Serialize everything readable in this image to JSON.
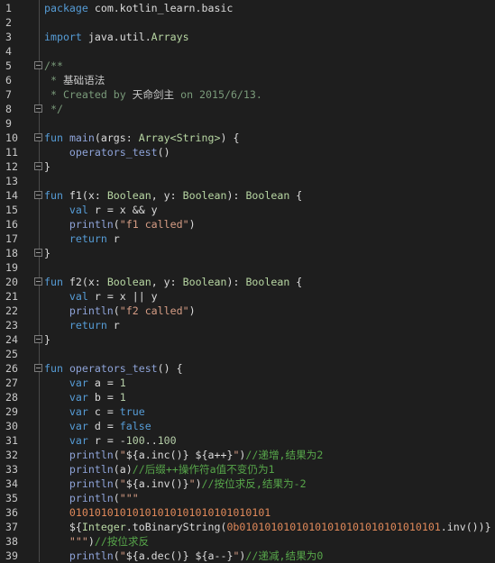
{
  "editor": {
    "language": "kotlin",
    "lines": [
      {
        "n": "1",
        "tokens": [
          [
            "kw",
            "package"
          ],
          [
            "pl",
            " com.kotlin_learn.basic"
          ]
        ]
      },
      {
        "n": "2",
        "tokens": []
      },
      {
        "n": "3",
        "tokens": [
          [
            "kw",
            "import"
          ],
          [
            "pl",
            " java.util."
          ],
          [
            "ty",
            "Arrays"
          ]
        ]
      },
      {
        "n": "4",
        "tokens": []
      },
      {
        "n": "5",
        "fold": "start",
        "tokens": [
          [
            "doc",
            "/**"
          ]
        ]
      },
      {
        "n": "6",
        "tokens": [
          [
            "doc",
            " * "
          ],
          [
            "docT",
            "基础语法"
          ]
        ]
      },
      {
        "n": "7",
        "tokens": [
          [
            "doc",
            " * Created by "
          ],
          [
            "docT",
            "天命剑主"
          ],
          [
            "doc",
            " on 2015/6/13."
          ]
        ]
      },
      {
        "n": "8",
        "fold": "end",
        "tokens": [
          [
            "doc",
            " */"
          ]
        ]
      },
      {
        "n": "9",
        "tokens": []
      },
      {
        "n": "10",
        "fold": "start",
        "tokens": [
          [
            "kw",
            "fun"
          ],
          [
            "pl",
            " "
          ],
          [
            "fn",
            "main"
          ],
          [
            "pl",
            "(args: "
          ],
          [
            "ty",
            "Array<String>"
          ],
          [
            "pl",
            ") {"
          ]
        ]
      },
      {
        "n": "11",
        "tokens": [
          [
            "pl",
            "    "
          ],
          [
            "fn",
            "operators_test"
          ],
          [
            "pl",
            "()"
          ]
        ]
      },
      {
        "n": "12",
        "fold": "end",
        "tokens": [
          [
            "pl",
            "}"
          ]
        ]
      },
      {
        "n": "13",
        "tokens": []
      },
      {
        "n": "14",
        "fold": "start",
        "tokens": [
          [
            "kw",
            "fun"
          ],
          [
            "pl",
            " f1(x: "
          ],
          [
            "ty",
            "Boolean"
          ],
          [
            "pl",
            ", y: "
          ],
          [
            "ty",
            "Boolean"
          ],
          [
            "pl",
            "): "
          ],
          [
            "ty",
            "Boolean"
          ],
          [
            "pl",
            " {"
          ]
        ]
      },
      {
        "n": "15",
        "tokens": [
          [
            "pl",
            "    "
          ],
          [
            "kw",
            "val"
          ],
          [
            "pl",
            " r = x && y"
          ]
        ]
      },
      {
        "n": "16",
        "tokens": [
          [
            "pl",
            "    "
          ],
          [
            "fn",
            "println"
          ],
          [
            "pl",
            "("
          ],
          [
            "str",
            "\"f1 called\""
          ],
          [
            "pl",
            ")"
          ]
        ]
      },
      {
        "n": "17",
        "tokens": [
          [
            "pl",
            "    "
          ],
          [
            "kw",
            "return"
          ],
          [
            "pl",
            " r"
          ]
        ]
      },
      {
        "n": "18",
        "fold": "end",
        "tokens": [
          [
            "pl",
            "}"
          ]
        ]
      },
      {
        "n": "19",
        "tokens": []
      },
      {
        "n": "20",
        "fold": "start",
        "tokens": [
          [
            "kw",
            "fun"
          ],
          [
            "pl",
            " f2(x: "
          ],
          [
            "ty",
            "Boolean"
          ],
          [
            "pl",
            ", y: "
          ],
          [
            "ty",
            "Boolean"
          ],
          [
            "pl",
            "): "
          ],
          [
            "ty",
            "Boolean"
          ],
          [
            "pl",
            " {"
          ]
        ]
      },
      {
        "n": "21",
        "tokens": [
          [
            "pl",
            "    "
          ],
          [
            "kw",
            "val"
          ],
          [
            "pl",
            " r = x || y"
          ]
        ]
      },
      {
        "n": "22",
        "tokens": [
          [
            "pl",
            "    "
          ],
          [
            "fn",
            "println"
          ],
          [
            "pl",
            "("
          ],
          [
            "str",
            "\"f2 called\""
          ],
          [
            "pl",
            ")"
          ]
        ]
      },
      {
        "n": "23",
        "tokens": [
          [
            "pl",
            "    "
          ],
          [
            "kw",
            "return"
          ],
          [
            "pl",
            " r"
          ]
        ]
      },
      {
        "n": "24",
        "fold": "end",
        "tokens": [
          [
            "pl",
            "}"
          ]
        ]
      },
      {
        "n": "25",
        "tokens": []
      },
      {
        "n": "26",
        "fold": "start",
        "tokens": [
          [
            "kw",
            "fun"
          ],
          [
            "pl",
            " "
          ],
          [
            "fn",
            "operators_test"
          ],
          [
            "pl",
            "() {"
          ]
        ]
      },
      {
        "n": "27",
        "tokens": [
          [
            "pl",
            "    "
          ],
          [
            "kw",
            "var"
          ],
          [
            "pl",
            " a = "
          ],
          [
            "num",
            "1"
          ]
        ]
      },
      {
        "n": "28",
        "tokens": [
          [
            "pl",
            "    "
          ],
          [
            "kw",
            "var"
          ],
          [
            "pl",
            " b = "
          ],
          [
            "num",
            "1"
          ]
        ]
      },
      {
        "n": "29",
        "tokens": [
          [
            "pl",
            "    "
          ],
          [
            "kw",
            "var"
          ],
          [
            "pl",
            " c = "
          ],
          [
            "kw",
            "true"
          ]
        ]
      },
      {
        "n": "30",
        "tokens": [
          [
            "pl",
            "    "
          ],
          [
            "kw",
            "var"
          ],
          [
            "pl",
            " d = "
          ],
          [
            "kw",
            "false"
          ]
        ]
      },
      {
        "n": "31",
        "tokens": [
          [
            "pl",
            "    "
          ],
          [
            "kw",
            "var"
          ],
          [
            "pl",
            " r = -"
          ],
          [
            "num",
            "100"
          ],
          [
            "pl",
            ".."
          ],
          [
            "num",
            "100"
          ]
        ]
      },
      {
        "n": "32",
        "tokens": [
          [
            "pl",
            "    "
          ],
          [
            "fn",
            "println"
          ],
          [
            "pl",
            "("
          ],
          [
            "str",
            "\""
          ],
          [
            "pl",
            "${a.inc()} ${a++}"
          ],
          [
            "str",
            "\""
          ],
          [
            "pl",
            ")"
          ],
          [
            "cmt",
            "//递增,结果为2"
          ]
        ]
      },
      {
        "n": "33",
        "tokens": [
          [
            "pl",
            "    "
          ],
          [
            "fn",
            "println"
          ],
          [
            "pl",
            "(a)"
          ],
          [
            "cmt",
            "//后缀++操作符a值不变仍为1"
          ]
        ]
      },
      {
        "n": "34",
        "tokens": [
          [
            "pl",
            "    "
          ],
          [
            "fn",
            "println"
          ],
          [
            "pl",
            "("
          ],
          [
            "str",
            "\""
          ],
          [
            "pl",
            "${a.inv()}"
          ],
          [
            "str",
            "\""
          ],
          [
            "pl",
            ")"
          ],
          [
            "cmt",
            "//按位求反,结果为-2"
          ]
        ]
      },
      {
        "n": "35",
        "tokens": [
          [
            "pl",
            "    "
          ],
          [
            "fn",
            "println"
          ],
          [
            "pl",
            "("
          ],
          [
            "str",
            "\"\"\""
          ]
        ]
      },
      {
        "n": "36",
        "tokens": [
          [
            "pl",
            "    "
          ],
          [
            "bin",
            "01010101010101010101010101010101"
          ]
        ]
      },
      {
        "n": "37",
        "tokens": [
          [
            "pl",
            "    ${"
          ],
          [
            "ty",
            "Integer"
          ],
          [
            "pl",
            ".toBinaryString("
          ],
          [
            "bin",
            "0b01010101010101010101010101010101"
          ],
          [
            "pl",
            ".inv())}"
          ]
        ]
      },
      {
        "n": "38",
        "tokens": [
          [
            "pl",
            "    "
          ],
          [
            "str",
            "\"\"\""
          ],
          [
            "pl",
            ")"
          ],
          [
            "cmt",
            "//按位求反"
          ]
        ]
      },
      {
        "n": "39",
        "tokens": [
          [
            "pl",
            "    "
          ],
          [
            "fn",
            "println"
          ],
          [
            "pl",
            "("
          ],
          [
            "str",
            "\""
          ],
          [
            "pl",
            "${a.dec()} ${a--}"
          ],
          [
            "str",
            "\""
          ],
          [
            "pl",
            ")"
          ],
          [
            "cmt",
            "//递减,结果为0"
          ]
        ]
      }
    ]
  }
}
